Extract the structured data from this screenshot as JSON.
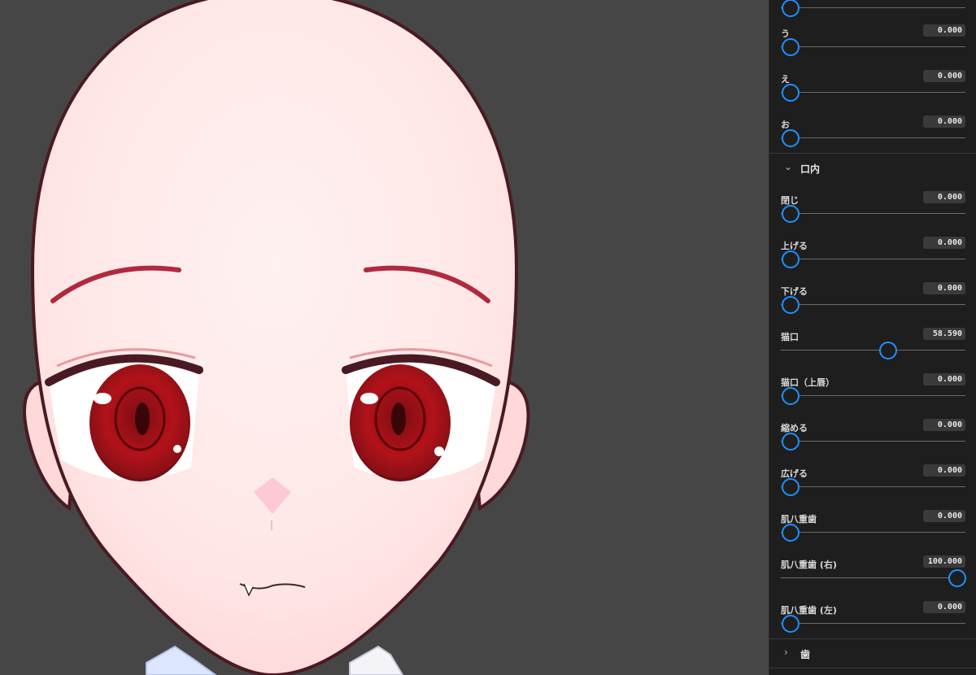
{
  "panel": {
    "sections": [
      {
        "title": "口内",
        "expanded": true,
        "chevron": "chevron-down-icon"
      },
      {
        "title": "歯",
        "expanded": false,
        "chevron": "chevron-right-icon"
      }
    ],
    "top_sliders": [
      {
        "label": "",
        "value": "0.000",
        "fraction": 0.0
      },
      {
        "label": "う",
        "value": "0.000",
        "fraction": 0.0
      },
      {
        "label": "え",
        "value": "0.000",
        "fraction": 0.0
      },
      {
        "label": "お",
        "value": "0.000",
        "fraction": 0.0
      }
    ],
    "mouth_sliders": [
      {
        "label": "閉じ",
        "value": "0.000",
        "fraction": 0.0
      },
      {
        "label": "上げる",
        "value": "0.000",
        "fraction": 0.0
      },
      {
        "label": "下げる",
        "value": "0.000",
        "fraction": 0.0
      },
      {
        "label": "猫口",
        "value": "58.590",
        "fraction": 0.5859
      },
      {
        "label": "猫口（上唇）",
        "value": "0.000",
        "fraction": 0.0
      },
      {
        "label": "縮める",
        "value": "0.000",
        "fraction": 0.0
      },
      {
        "label": "広げる",
        "value": "0.000",
        "fraction": 0.0
      },
      {
        "label": "肌八重歯",
        "value": "0.000",
        "fraction": 0.0
      },
      {
        "label": "肌八重歯 (右)",
        "value": "100.000",
        "fraction": 1.0
      },
      {
        "label": "肌八重歯 (左)",
        "value": "0.000",
        "fraction": 0.0
      }
    ]
  },
  "colors": {
    "background": "#464646",
    "panel": "#1e1e1e",
    "accent": "#1e90ff",
    "skin": "#ffe3e3",
    "outline": "#4a1a22",
    "eye_red": "#b3121a"
  }
}
